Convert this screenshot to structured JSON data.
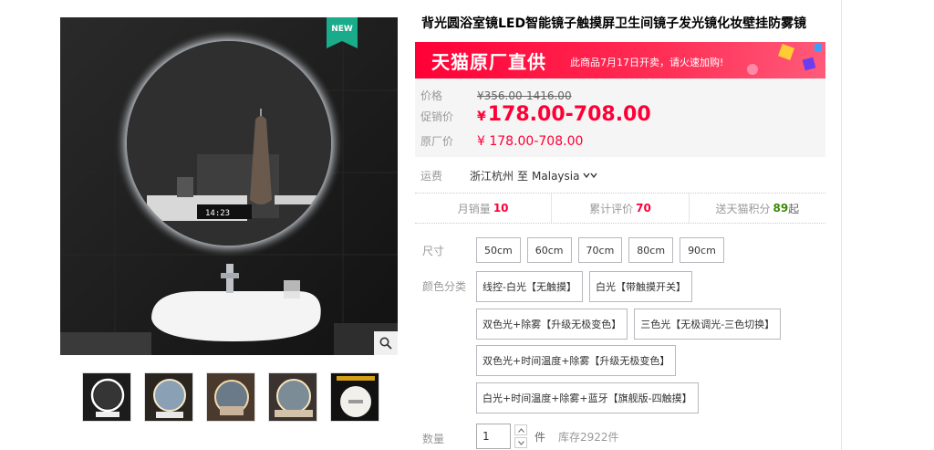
{
  "product": {
    "title": "背光圆浴室镜LED智能镜子触摸屏卫生间镜子发光镜化妆壁挂防雾镜",
    "new_badge": "NEW",
    "mirror_clock": "14:23"
  },
  "banner": {
    "title": "天猫原厂直供",
    "note": "此商品7月17日开卖，请火速加购!"
  },
  "price": {
    "price_label": "价格",
    "price_value": "¥356.00-1416.00",
    "promo_label": "促销价",
    "promo_currency": "¥",
    "promo_value": "178.00-708.00",
    "factory_label": "原厂价",
    "factory_value": "¥ 178.00-708.00"
  },
  "shipping": {
    "label": "运费",
    "origin": "浙江杭州",
    "to": "至",
    "destination": "Malaysia"
  },
  "stats": {
    "monthly_label": "月销量",
    "monthly_value": "10",
    "reviews_label": "累计评价",
    "reviews_value": "70",
    "points_label": "送天猫积分",
    "points_value": "89",
    "points_suffix": "起"
  },
  "options": {
    "size_label": "尺寸",
    "sizes": [
      "50cm",
      "60cm",
      "70cm",
      "80cm",
      "90cm"
    ],
    "color_label": "颜色分类",
    "colors": [
      "线控-白光【无触摸】",
      "白光【带触摸开关】",
      "双色光+除雾【升级无极变色】",
      "三色光【无极调光-三色切换】",
      "双色光+时间温度+除雾【升级无极变色】",
      "白光+时间温度+除雾+蓝牙【旗舰版-四触摸】"
    ]
  },
  "quantity": {
    "label": "数量",
    "value": "1",
    "unit": "件",
    "stock": "库存2922件"
  },
  "icons": {
    "zoom": "magnifier-icon",
    "chevron": "chevron-down-icon"
  },
  "colors": {
    "accent": "#ff0036",
    "badge": "#1aab8a",
    "points": "#3b8b07"
  }
}
